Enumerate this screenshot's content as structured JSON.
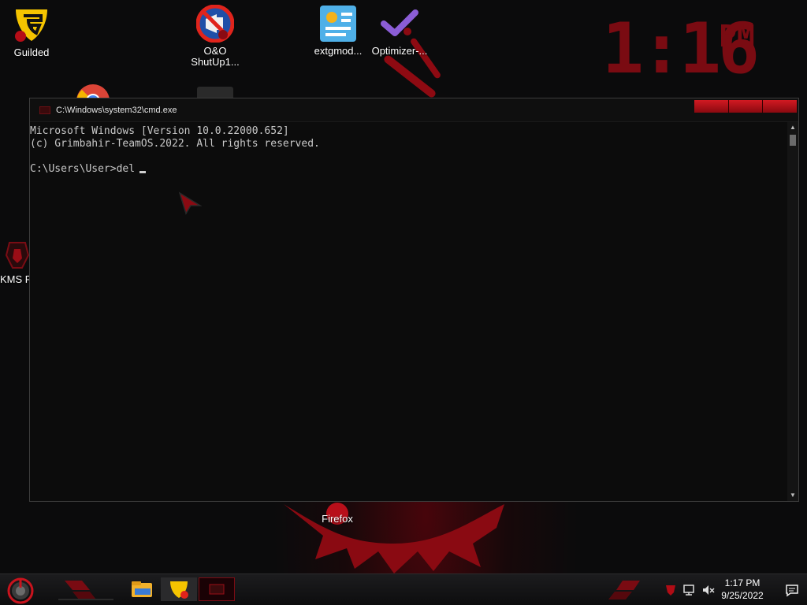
{
  "wallpaper": {
    "clock_time": "1:16",
    "clock_ampm": "PM",
    "accent": "#8e0a12"
  },
  "desktop_icons": [
    {
      "label": "Guilded",
      "icon": "guilded-icon"
    },
    {
      "label": "O&O ShutUp1...",
      "icon": "shutup-icon"
    },
    {
      "label": "extgmod...",
      "icon": "extgmod-icon"
    },
    {
      "label": "Optimizer-...",
      "icon": "optimizer-icon"
    },
    {
      "label": "KMS Port",
      "icon": "kms-icon"
    },
    {
      "label": "Firefox",
      "icon": "firefox-icon"
    }
  ],
  "cmd": {
    "title": "C:\\Windows\\system32\\cmd.exe",
    "lines": [
      "Microsoft Windows [Version 10.0.22000.652]",
      "(c) Grimbahir-TeamOS.2022. All rights reserved.",
      "",
      "C:\\Users\\User>del"
    ]
  },
  "taskbar": {
    "time": "1:17 PM",
    "date": "9/25/2022",
    "apps": [
      "file-explorer-icon",
      "guilded-icon",
      "cmd-icon"
    ]
  }
}
